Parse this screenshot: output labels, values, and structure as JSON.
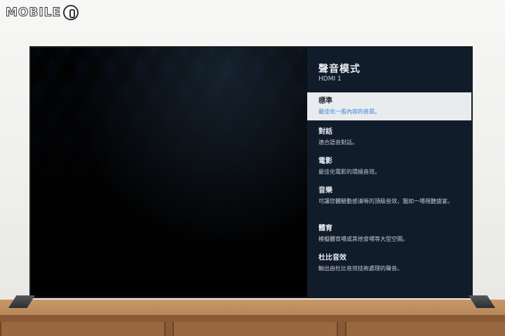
{
  "watermark": {
    "logo_text": "MOBILE",
    "icon": "mobile01-mark-icon"
  },
  "menu": {
    "title": "聲音模式",
    "subtitle": "HDMI 1",
    "items": [
      {
        "title": "標準",
        "desc": "最佳化一般內容的音質。",
        "selected": true
      },
      {
        "title": "對話",
        "desc": "適合語音對話。",
        "selected": false
      },
      {
        "title": "電影",
        "desc": "最佳化電影的環繞音效。",
        "selected": false
      },
      {
        "title": "音樂",
        "desc": "可讓您體驗動感清晰的頂級音效，猶如一場視聽盛宴。",
        "selected": false
      },
      {
        "title": "體育",
        "desc": "模擬體育場或其他會場等大型空間。",
        "selected": false
      },
      {
        "title": "杜比音效",
        "desc": "輸出由杜比音效技術處理的聲音。",
        "selected": false
      }
    ]
  },
  "colors": {
    "panel_bg": "#111c2b",
    "selected_bg": "#e9ecef",
    "selected_desc": "#3d7fd6"
  }
}
